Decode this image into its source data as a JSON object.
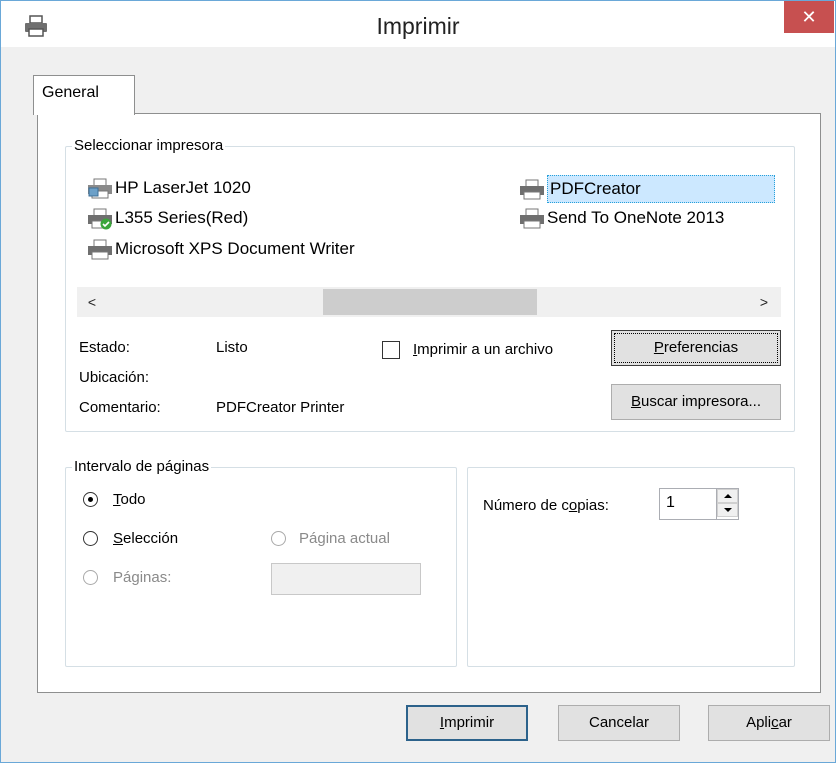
{
  "window": {
    "title": "Imprimir",
    "close_symbol": "✕"
  },
  "tabs": [
    {
      "label": "General"
    }
  ],
  "printer_group": {
    "legend": "Seleccionar impresora",
    "printers": [
      {
        "name": "HP LaserJet 1020",
        "icon": "network-printer-icon",
        "selected": false
      },
      {
        "name": "L355 Series(Red)",
        "icon": "default-printer-icon",
        "selected": false
      },
      {
        "name": "Microsoft XPS Document Writer",
        "icon": "printer-icon",
        "selected": false
      },
      {
        "name": "PDFCreator",
        "icon": "printer-icon",
        "selected": true
      },
      {
        "name": "Send To OneNote 2013",
        "icon": "printer-icon",
        "selected": false
      }
    ],
    "scroll_left": "<",
    "scroll_right": ">",
    "status_label": "Estado:",
    "status_value": "Listo",
    "location_label": "Ubicación:",
    "location_value": "",
    "comment_label": "Comentario:",
    "comment_value": "PDFCreator Printer",
    "print_to_file": {
      "label": "Imprimir a un archivo",
      "checked": false,
      "access_key": "I"
    },
    "preferences_button": {
      "label": "Preferencias",
      "access_key": "P"
    },
    "find_printer_button": {
      "label": "Buscar impresora...",
      "access_key": "B"
    }
  },
  "page_range_group": {
    "legend": "Intervalo de páginas",
    "options": {
      "all": {
        "label": "Todo",
        "checked": true,
        "access_key": "T"
      },
      "selection": {
        "label": "Selección",
        "checked": false,
        "access_key": "S"
      },
      "current_page": {
        "label": "Página actual",
        "checked": false,
        "disabled": true
      },
      "pages": {
        "label": "Páginas:",
        "checked": false,
        "disabled": true
      }
    },
    "pages_value": ""
  },
  "copies_group": {
    "label": "Número de copias:",
    "value": "1"
  },
  "buttons": {
    "print": "Imprimir",
    "cancel": "Cancelar",
    "apply": "Aplicar"
  }
}
